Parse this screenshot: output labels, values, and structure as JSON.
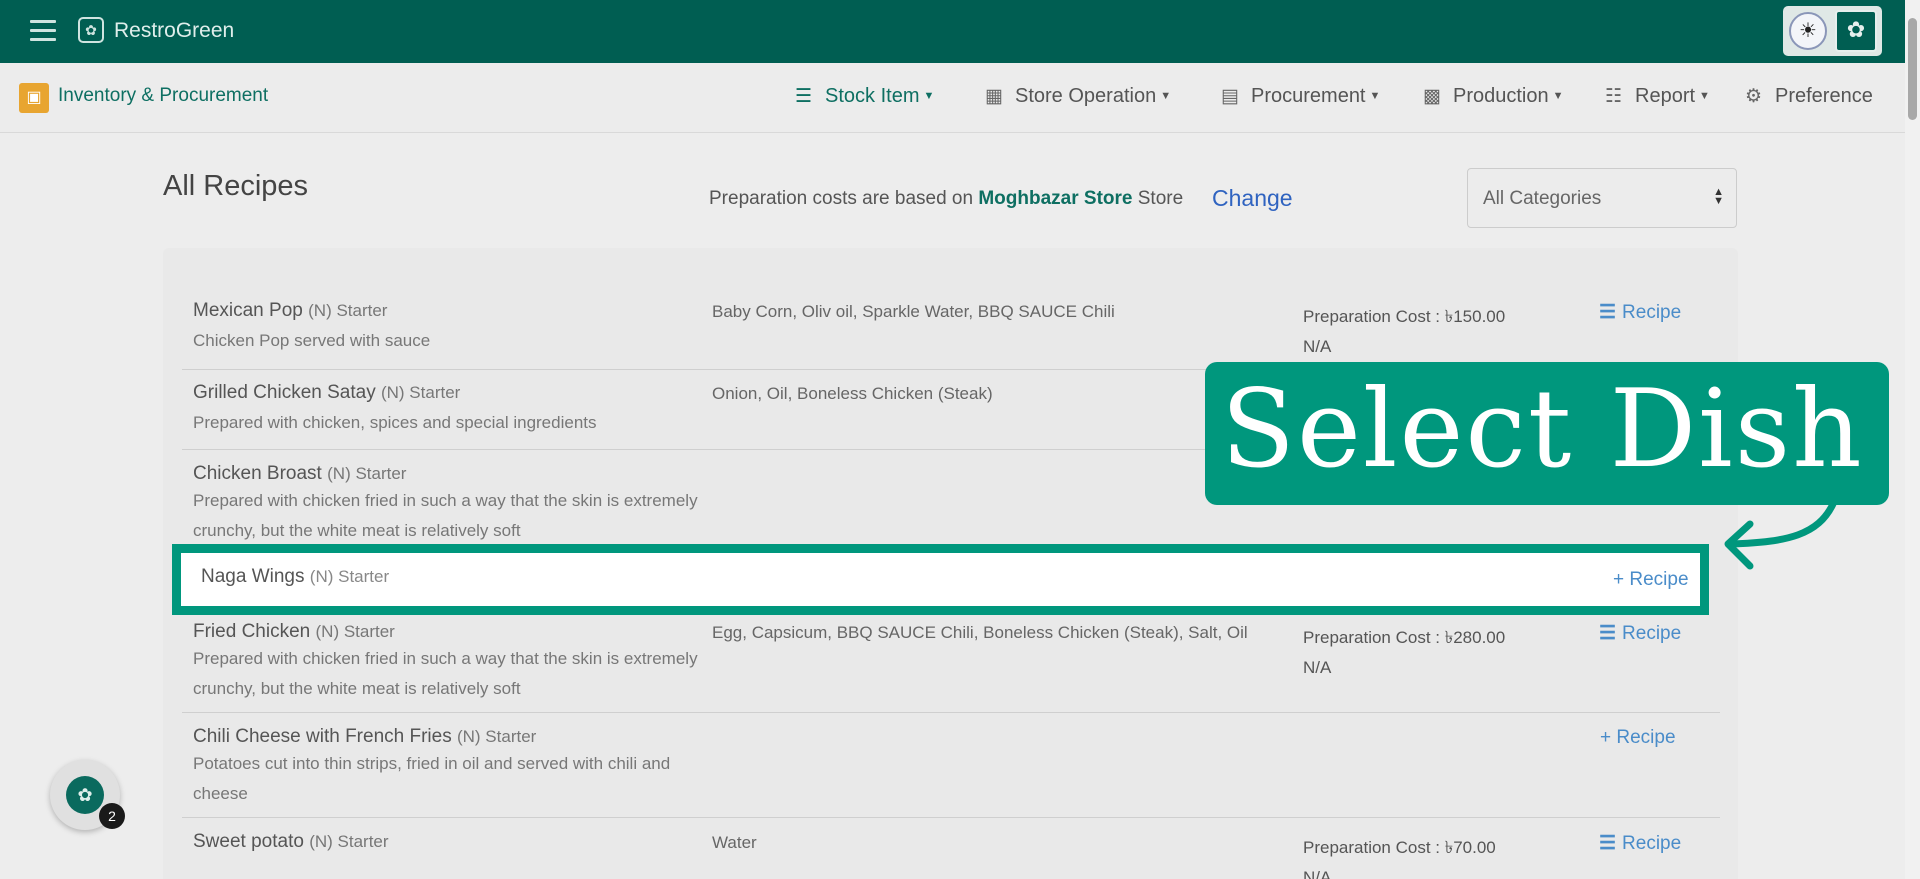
{
  "app": {
    "brand": "RestroGreen",
    "icons": {
      "menu": "hamburger-icon",
      "logo": "leaf-icon"
    }
  },
  "module": {
    "title": "Inventory & Procurement",
    "nav": [
      {
        "label": "Stock Item",
        "icon": "list-icon",
        "active": true
      },
      {
        "label": "Store Operation",
        "icon": "store-icon"
      },
      {
        "label": "Procurement",
        "icon": "server-icon"
      },
      {
        "label": "Production",
        "icon": "calculator-icon"
      },
      {
        "label": "Report",
        "icon": "clipboard-icon"
      },
      {
        "label": "Preference",
        "icon": "gear-icon"
      }
    ]
  },
  "page": {
    "title": "All Recipes",
    "prep_prefix": "Preparation costs are based on",
    "store_name": "Moghbazar Store",
    "store_suffix": "Store",
    "change_label": "Change",
    "category_select": "All Categories"
  },
  "recipes": [
    {
      "name": "Mexican Pop",
      "tag": "(N) Starter",
      "desc": "Chicken Pop served with sauce",
      "ingredients": "Baby Corn, Oliv oil, Sparkle Water, BBQ SAUCE Chili",
      "cost": "Preparation Cost : ৳150.00",
      "cost_note": "N/A",
      "action": "Recipe"
    },
    {
      "name": "Grilled Chicken Satay",
      "tag": "(N) Starter",
      "desc": "Prepared with chicken, spices and special ingredients",
      "ingredients": "Onion, Oil, Boneless Chicken (Steak)",
      "cost": "",
      "cost_note": "",
      "action": ""
    },
    {
      "name": "Chicken Broast",
      "tag": "(N) Starter",
      "desc": "Prepared with chicken fried in such a way that the skin is extremely crunchy, but the white meat is relatively soft",
      "ingredients": "",
      "cost": "",
      "cost_note": "",
      "action": ""
    },
    {
      "name": "Naga Wings",
      "tag": "(N) Starter",
      "desc": "",
      "ingredients": "",
      "cost": "",
      "cost_note": "",
      "action": "+ Recipe"
    },
    {
      "name": "Fried Chicken",
      "tag": "(N) Starter",
      "desc": "Prepared with chicken fried in such a way that the skin is extremely crunchy, but the white meat is relatively soft",
      "ingredients": "Egg, Capsicum, BBQ SAUCE Chili, Boneless Chicken (Steak), Salt, Oil",
      "cost": "Preparation Cost : ৳280.00",
      "cost_note": "N/A",
      "action": "Recipe"
    },
    {
      "name": "Chili Cheese with French Fries",
      "tag": "(N) Starter",
      "desc": "Potatoes cut into thin strips, fried in oil and served with chili and cheese",
      "ingredients": "",
      "cost": "",
      "cost_note": "",
      "action": "+ Recipe"
    },
    {
      "name": "Sweet potato",
      "tag": "(N) Starter",
      "desc": "",
      "ingredients": "Water",
      "cost": "Preparation Cost : ৳70.00",
      "cost_note": "N/A",
      "action": "Recipe"
    }
  ],
  "callout": {
    "text": "Select Dish"
  },
  "chat": {
    "badge": "2"
  }
}
